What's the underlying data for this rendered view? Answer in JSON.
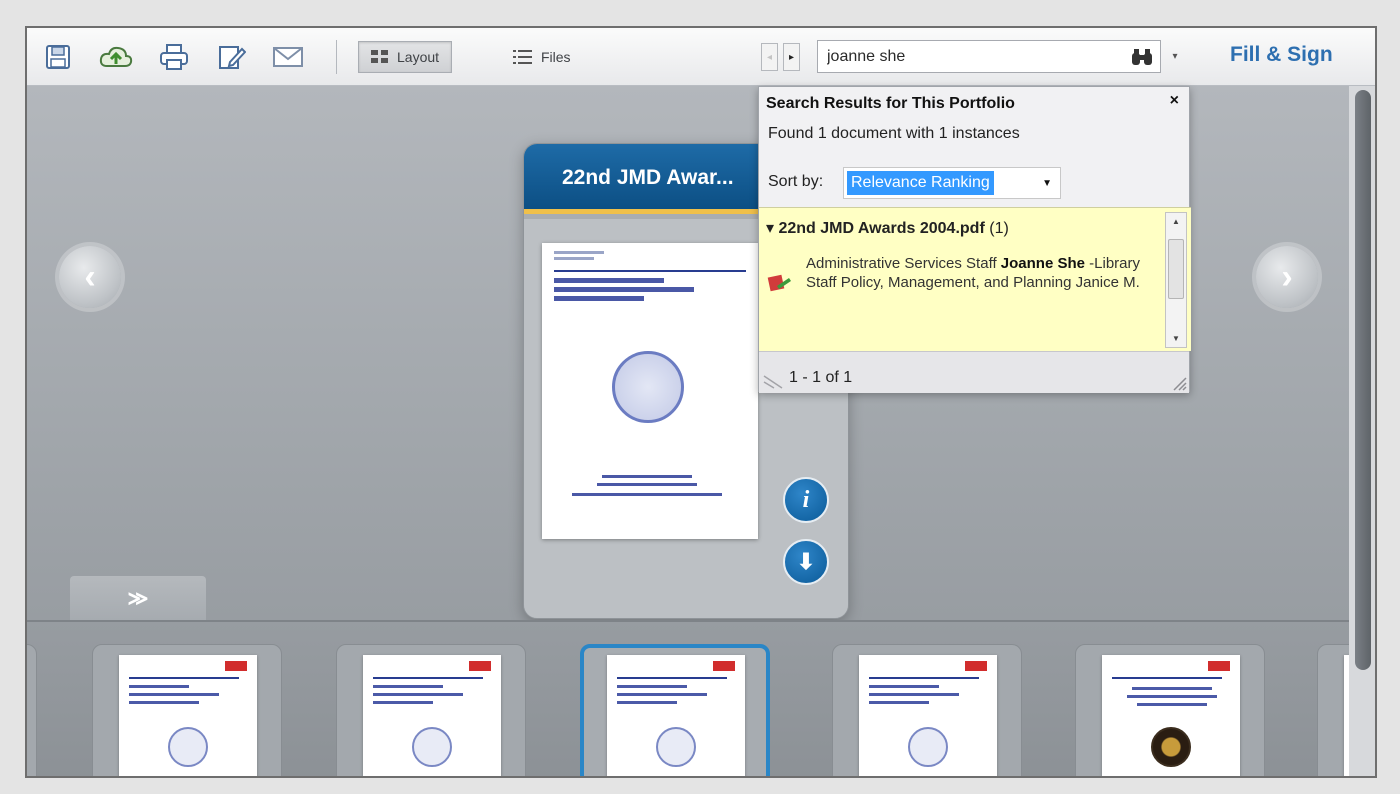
{
  "toolbar": {
    "icons": [
      "save-icon",
      "cloud-upload-icon",
      "print-icon",
      "edit-icon",
      "email-icon"
    ],
    "layout_label": "Layout",
    "files_label": "Files",
    "prev_arrow": "◂",
    "next_arrow": "▸",
    "search_value": "joanne she",
    "search_dropdown": "▾",
    "fill_sign_label": "Fill & Sign"
  },
  "card": {
    "title": "22nd JMD Awar..."
  },
  "stage": {
    "prev_glyph": "‹",
    "next_glyph": "›",
    "collapse_glyph": "≫",
    "info_glyph": "i",
    "download_glyph": "⬇"
  },
  "search_popup": {
    "title": "Search Results for This Portfolio",
    "close_glyph": "×",
    "found_text": "Found 1 document with 1 instances",
    "sort_label": "Sort by:",
    "sort_value": "Relevance Ranking",
    "sort_dropdown": "▼",
    "result": {
      "expand_glyph": "▾",
      "file_name": "22nd JMD Awards 2004.pdf",
      "count": "(1)",
      "snippet_before": "Administrative Services Staff ",
      "snippet_match": "Joanne She",
      "snippet_after": " -Library Staff Policy, Management, and Planning Janice M."
    },
    "pagination": "1 - 1 of 1"
  },
  "colors": {
    "accent": "#2d6fb0",
    "card_header": "#1e6ba7",
    "highlight": "#3399ff",
    "results_bg": "#ffffc4"
  }
}
